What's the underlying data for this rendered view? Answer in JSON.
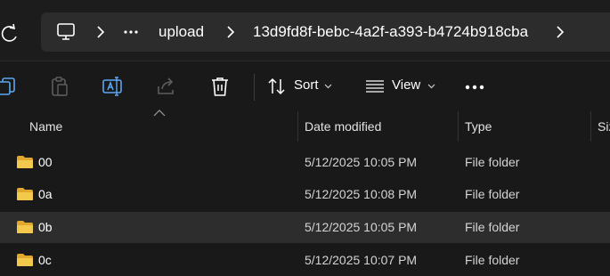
{
  "address_bar": {
    "crumbs": [
      "upload",
      "13d9fd8f-bebc-4a2f-a393-b4724b918cba"
    ]
  },
  "toolbar": {
    "sort_label": "Sort",
    "view_label": "View"
  },
  "columns": {
    "name": "Name",
    "date": "Date modified",
    "type": "Type",
    "size": "Size"
  },
  "rows": [
    {
      "name": "00",
      "date": "5/12/2025 10:05 PM",
      "type": "File folder"
    },
    {
      "name": "0a",
      "date": "5/12/2025 10:08 PM",
      "type": "File folder"
    },
    {
      "name": "0b",
      "date": "5/12/2025 10:05 PM",
      "type": "File folder"
    },
    {
      "name": "0c",
      "date": "5/12/2025 10:07 PM",
      "type": "File folder"
    }
  ],
  "colors": {
    "folder": "#f2c94c",
    "selected_row": "#2d2d2d",
    "accent_icon": "#5aa7f0"
  }
}
